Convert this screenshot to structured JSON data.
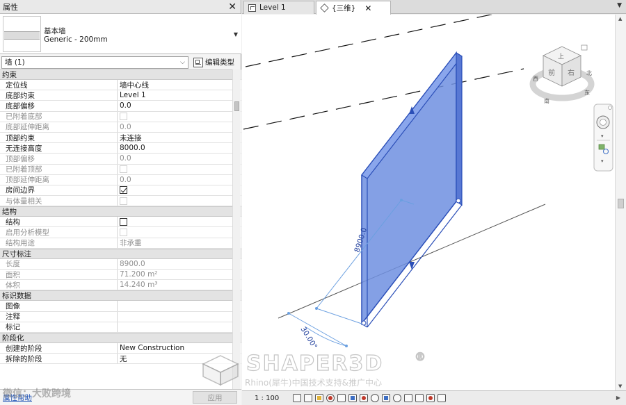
{
  "properties": {
    "title": "属性",
    "close_glyph": "✕",
    "type_family": "基本墙",
    "type_name": "Generic - 200mm",
    "instance_label": "墙 (1)",
    "edit_type_label": "编辑类型",
    "help_label": "属性帮助",
    "apply_label": "应用",
    "sections": [
      {
        "title": "约束",
        "rows": [
          {
            "label": "定位线",
            "value": "墙中心线",
            "kind": "text"
          },
          {
            "label": "底部约束",
            "value": "Level 1",
            "kind": "text"
          },
          {
            "label": "底部偏移",
            "value": "0.0",
            "kind": "text"
          },
          {
            "label": "已附着底部",
            "value": "",
            "kind": "checkbox-disabled"
          },
          {
            "label": "底部延伸距离",
            "value": "0.0",
            "kind": "disabled"
          },
          {
            "label": "顶部约束",
            "value": "未连接",
            "kind": "text"
          },
          {
            "label": "无连接高度",
            "value": "8000.0",
            "kind": "text"
          },
          {
            "label": "顶部偏移",
            "value": "0.0",
            "kind": "disabled"
          },
          {
            "label": "已附着顶部",
            "value": "",
            "kind": "checkbox-disabled"
          },
          {
            "label": "顶部延伸距离",
            "value": "0.0",
            "kind": "disabled"
          },
          {
            "label": "房间边界",
            "value": "",
            "kind": "checkbox-on"
          },
          {
            "label": "与体量相关",
            "value": "",
            "kind": "checkbox-disabled"
          }
        ]
      },
      {
        "title": "结构",
        "rows": [
          {
            "label": "结构",
            "value": "",
            "kind": "checkbox"
          },
          {
            "label": "启用分析模型",
            "value": "",
            "kind": "checkbox-disabled"
          },
          {
            "label": "结构用途",
            "value": "非承重",
            "kind": "disabled"
          }
        ]
      },
      {
        "title": "尺寸标注",
        "rows": [
          {
            "label": "长度",
            "value": "8900.0",
            "kind": "disabled"
          },
          {
            "label": "面积",
            "value": "71.200 m²",
            "kind": "disabled"
          },
          {
            "label": "体积",
            "value": "14.240 m³",
            "kind": "disabled"
          }
        ]
      },
      {
        "title": "标识数据",
        "rows": [
          {
            "label": "图像",
            "value": "",
            "kind": "text"
          },
          {
            "label": "注释",
            "value": "",
            "kind": "text"
          },
          {
            "label": "标记",
            "value": "",
            "kind": "text"
          }
        ]
      },
      {
        "title": "阶段化",
        "rows": [
          {
            "label": "创建的阶段",
            "value": "New Construction",
            "kind": "text"
          },
          {
            "label": "拆除的阶段",
            "value": "无",
            "kind": "text"
          }
        ]
      }
    ]
  },
  "tabs": [
    {
      "label": "Level 1",
      "icon": "floor-plan-icon"
    },
    {
      "label": "{三维}",
      "icon": "3d-view-icon"
    }
  ],
  "view": {
    "dim_length": "8900.0",
    "dim_angle": "30.00°",
    "viewcube_top": "上",
    "viewcube_front": "前",
    "viewcube_right": "右",
    "compass_n": "北",
    "compass_w": "西",
    "compass_s": "南",
    "compass_e": "东",
    "wall_color": "#6f8fe0",
    "wall_edge": "#2b4fb8"
  },
  "status": {
    "scale": "1 : 100"
  },
  "watermark": {
    "brand": "SHAPER3D",
    "reg": "®",
    "sub": "Rhino(犀牛)中国技术支持&推广中心",
    "corner": "微信：大败跨境"
  }
}
